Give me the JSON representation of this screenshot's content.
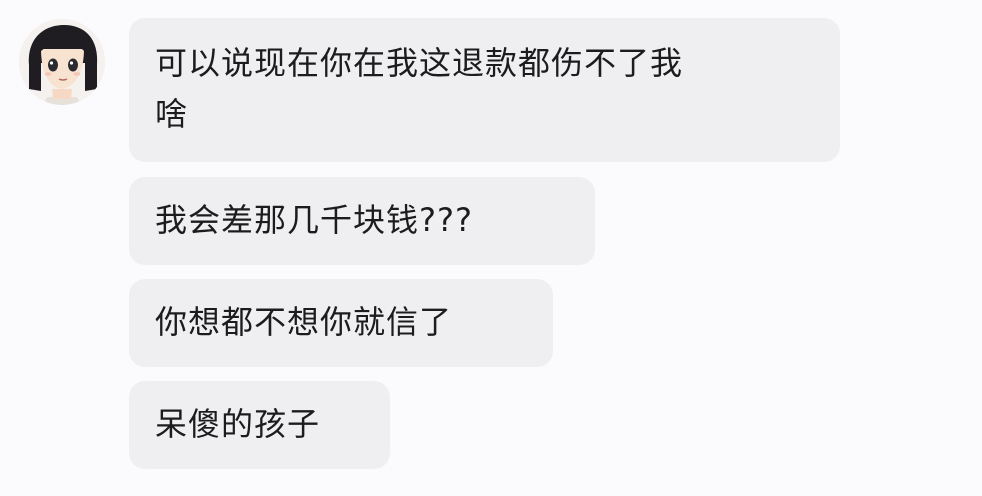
{
  "contact": {
    "avatar_icon": "anime-girl-avatar-icon"
  },
  "messages": [
    {
      "line1": "可以说现在你在我这退款都伤不了我",
      "line2": "啥"
    },
    {
      "text": "我会差那几千块钱???"
    },
    {
      "text": "你想都不想你就信了"
    },
    {
      "text": "呆傻的孩子"
    }
  ],
  "colors": {
    "background": "#fbfbfd",
    "bubble": "#efeff1",
    "text": "#1c1c1e"
  }
}
